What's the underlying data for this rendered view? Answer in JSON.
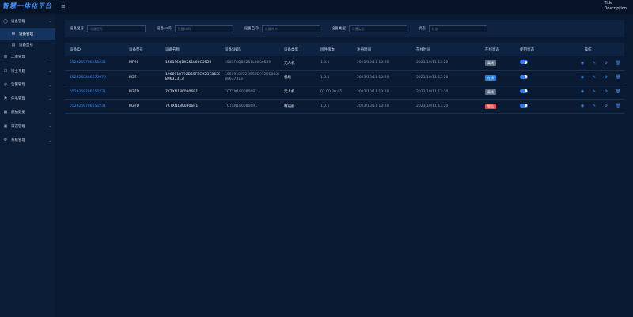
{
  "header": {
    "logo": "智慧一体化平台",
    "title": "Title",
    "description": "Description"
  },
  "sidebar": {
    "items": [
      {
        "icon": "◯",
        "label": "设备管理",
        "expanded": true
      },
      {
        "icon": "✉",
        "label": "设备管理",
        "sub": true,
        "active": true
      },
      {
        "icon": "▤",
        "label": "设备型号",
        "sub": true
      },
      {
        "icon": "▥",
        "label": "工单管理"
      },
      {
        "icon": "☐",
        "label": "行业专题"
      },
      {
        "icon": "◎",
        "label": "告警管理"
      },
      {
        "icon": "⚑",
        "label": "任务管理"
      },
      {
        "icon": "▦",
        "label": "航拍数据"
      },
      {
        "icon": "▣",
        "label": "日志管理"
      },
      {
        "icon": "⚙",
        "label": "系统管理"
      }
    ]
  },
  "filters": [
    {
      "label": "设备型号",
      "placeholder": "设备型号",
      "width": 74
    },
    {
      "label": "设备sn码",
      "placeholder": "设备sn码",
      "width": 74
    },
    {
      "label": "设备名称",
      "placeholder": "设备名称",
      "width": 74
    },
    {
      "label": "设备类型",
      "placeholder": "设备类型",
      "width": 74
    },
    {
      "label": "状态",
      "placeholder": "状态",
      "width": 74
    }
  ],
  "table": {
    "headers": [
      "设备ID",
      "设备型号",
      "设备名称",
      "设备SN码",
      "设备类型",
      "固件版本",
      "注册时间",
      "在线时间",
      "在线状态",
      "使用状态",
      "操作"
    ],
    "rows": [
      {
        "id": "6526259786655231",
        "model": "MP20",
        "name": "1581F6QBX251L00G0539",
        "sn": "1581F6QBX251L00G0539",
        "type": "无人机",
        "fw": "1.0.1",
        "reg": "2023/10/11 13:20",
        "online": "2023/10/11 13:20",
        "status": "离线",
        "status_color": "#5b6b82"
      },
      {
        "id": "6526260486672970",
        "model": "M3T",
        "name": "1968918722D55FEC92DE8638 89637313",
        "sn": "1968918722D55FEC92DE8638 89637313",
        "type": "机场",
        "fw": "1.0.1",
        "reg": "2023/10/11 13:20",
        "online": "2023/10/11 13:20",
        "status": "在线",
        "status_color": "#1e7df0"
      },
      {
        "id": "6526259786655231",
        "model": "M3TD",
        "name": "7CTXN1800806R1",
        "sn": "7CTXN1800806R1",
        "type": "无人机",
        "fw": "02.00.20.05",
        "reg": "2023/10/11 13:20",
        "online": "2023/10/11 13:20",
        "status": "离线",
        "status_color": "#5b6b82"
      },
      {
        "id": "6526259786655231",
        "model": "M3TD",
        "name": "7CTXN1800806R1",
        "sn": "7CTXN1800806R1",
        "type": "喊话器",
        "fw": "1.0.1",
        "reg": "2023/10/11 13:20",
        "online": "2023/10/11 13:20",
        "status": "警告",
        "status_color": "#e5484d"
      }
    ]
  },
  "icons": {
    "view": "eye-icon",
    "edit": "edit-icon",
    "settings": "gear-icon",
    "delete": "trash-icon"
  }
}
